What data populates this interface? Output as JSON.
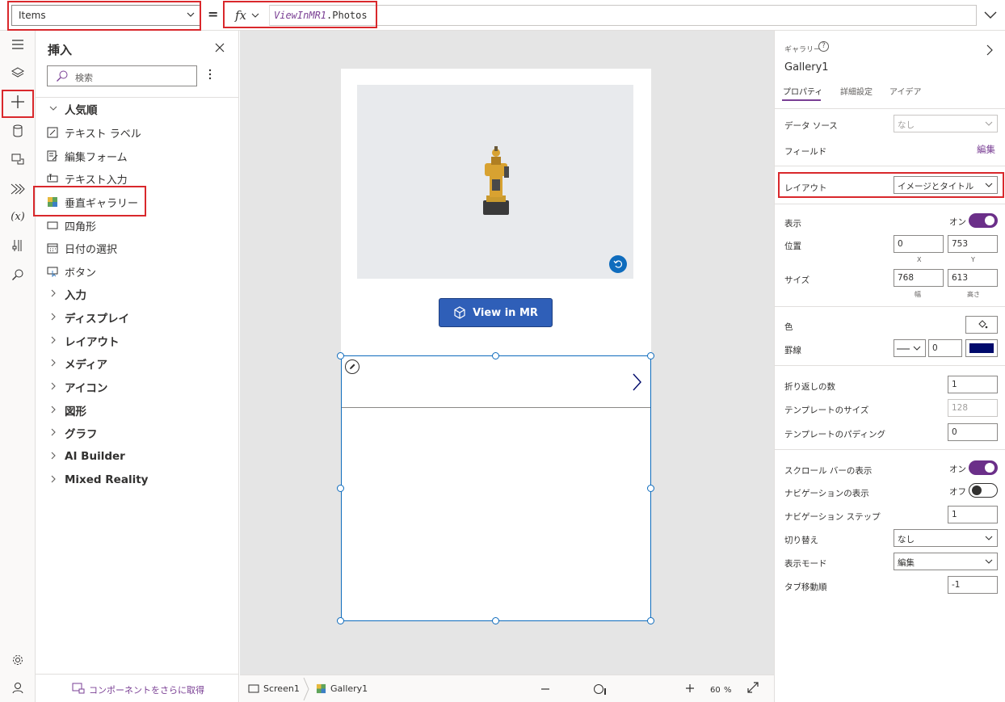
{
  "formula_bar": {
    "property": "Items",
    "equals": "=",
    "fx_label": "fx",
    "formula_control": "ViewInMR1",
    "formula_rest": ".Photos"
  },
  "insert_pane": {
    "title": "挿入",
    "search_placeholder": "検索",
    "popular_label": "人気順",
    "popular_items": [
      "テキスト ラベル",
      "編集フォーム",
      "テキスト入力",
      "垂直ギャラリー",
      "四角形",
      "日付の選択",
      "ボタン"
    ],
    "categories": [
      "入力",
      "ディスプレイ",
      "レイアウト",
      "メディア",
      "アイコン",
      "図形",
      "グラフ",
      "AI Builder",
      "Mixed Reality"
    ],
    "footer_link": "コンポーネントをさらに取得"
  },
  "canvas": {
    "view_in_mr_label": "View in MR"
  },
  "status_bar": {
    "screen_crumb": "Screen1",
    "gallery_crumb": "Gallery1",
    "zoom_value": "60",
    "zoom_unit": "%"
  },
  "properties": {
    "category": "ギャラリー",
    "help": "?",
    "control_name": "Gallery1",
    "tabs": [
      "プロパティ",
      "詳細設定",
      "アイデア"
    ],
    "data_source_label": "データ ソース",
    "data_source_value": "なし",
    "fields_label": "フィールド",
    "fields_link": "編集",
    "layout_label": "レイアウト",
    "layout_value": "イメージとタイトル",
    "visible_label": "表示",
    "visible_state": "オン",
    "position_label": "位置",
    "position_x": "0",
    "position_y": "753",
    "x_label": "X",
    "y_label": "Y",
    "size_label": "サイズ",
    "size_w": "768",
    "size_h": "613",
    "w_label": "幅",
    "h_label": "高さ",
    "color_label": "色",
    "border_label": "罫線",
    "border_width": "0",
    "border_color": "#000a6b",
    "wrap_count_label": "折り返しの数",
    "wrap_count": "1",
    "template_size_label": "テンプレートのサイズ",
    "template_size": "128",
    "template_padding_label": "テンプレートのパディング",
    "template_padding": "0",
    "scrollbar_label": "スクロール バーの表示",
    "scrollbar_state": "オン",
    "navigation_label": "ナビゲーションの表示",
    "navigation_state": "オフ",
    "nav_step_label": "ナビゲーション ステップ",
    "nav_step": "1",
    "transition_label": "切り替え",
    "transition_value": "なし",
    "display_mode_label": "表示モード",
    "display_mode_value": "編集",
    "tab_index_label": "タブ移動順",
    "tab_index": "-1"
  },
  "colors": {
    "accent": "#7a3f94",
    "highlight": "#d9282c",
    "selection": "#0f6cbd",
    "button": "#2f5fb8"
  }
}
